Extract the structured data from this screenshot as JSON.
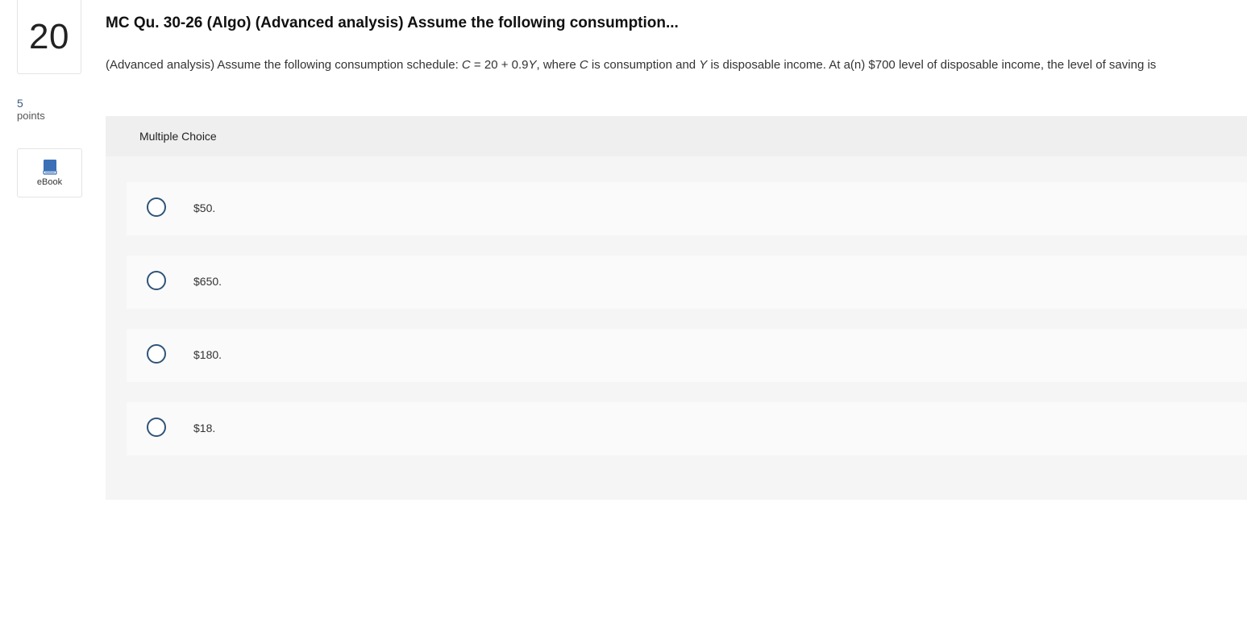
{
  "question": {
    "number": "20",
    "points_value": "5",
    "points_label": "points",
    "ebook_label": "eBook",
    "title": "MC Qu. 30-26 (Algo) (Advanced analysis) Assume the following consumption...",
    "text_parts": {
      "p1": "(Advanced analysis) Assume the following consumption schedule: ",
      "c1": "C",
      "p2": " = 20 + 0.9",
      "y1": "Y",
      "p3": ", where ",
      "c2": "C",
      "p4": " is consumption and ",
      "y2": "Y",
      "p5": " is disposable income. At a(n) $700 level of disposable income, the level of saving is"
    }
  },
  "multiple_choice": {
    "label": "Multiple Choice",
    "options": [
      {
        "label": "$50."
      },
      {
        "label": "$650."
      },
      {
        "label": "$180."
      },
      {
        "label": "$18."
      }
    ]
  },
  "icons": {
    "ebook": "book-icon",
    "radio": "radio-circle"
  },
  "colors": {
    "accent": "#2f5478",
    "ebook_icon": "#3b6fb6",
    "panel_bg": "#f5f5f5",
    "header_bg": "#efefef"
  }
}
